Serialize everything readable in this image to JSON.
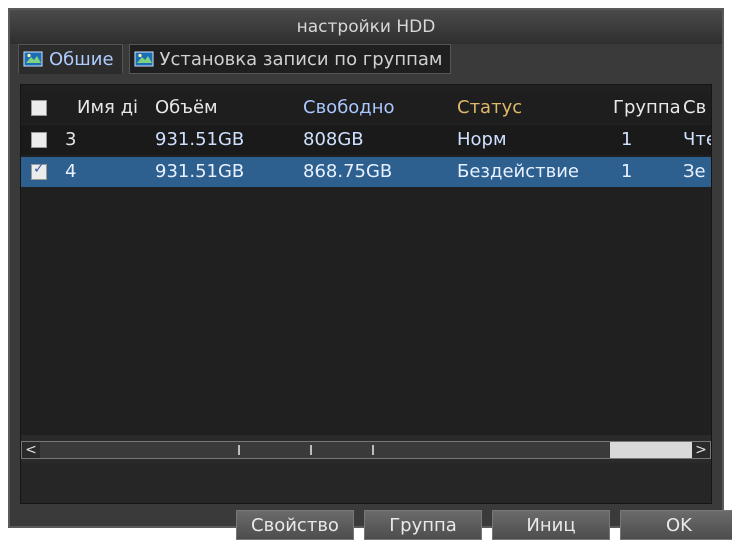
{
  "window": {
    "title": "настройки HDD"
  },
  "tabs": [
    {
      "label": "Обшие",
      "icon": "tab-image-icon"
    },
    {
      "label": "Установка записи по группам",
      "icon": "tab-image-icon"
    }
  ],
  "table": {
    "headers": [
      "Имя ді",
      "Объём",
      "Свободно",
      "Статус",
      "Группа",
      "Св"
    ],
    "rows": [
      {
        "checked": false,
        "name": "3",
        "volume": "931.51GB",
        "free": "808GB",
        "status": "Норм",
        "group": "1",
        "prop": "Чте"
      },
      {
        "checked": true,
        "name": "4",
        "volume": "931.51GB",
        "free": "868.75GB",
        "status": "Бездействие",
        "group": "1",
        "prop": "Зе"
      }
    ]
  },
  "scrollbar": {
    "left_arrow": "<",
    "right_arrow": ">"
  },
  "buttons": {
    "prop": "Свойство",
    "group": "Группа",
    "init": "Иниц",
    "ok": "OK"
  },
  "colors": {
    "selected_row": "#2d5f8f",
    "tab_active_text": "#aecbff",
    "header_status": "#e0b86a"
  }
}
